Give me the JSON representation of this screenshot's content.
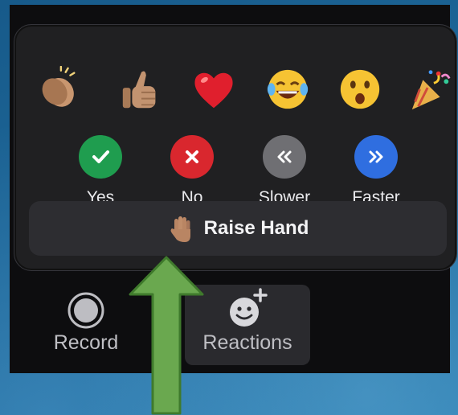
{
  "reactions": {
    "emojis": [
      {
        "name": "clapping-hands",
        "icon": "clap-icon"
      },
      {
        "name": "thumbs-up",
        "icon": "thumbs-up-icon"
      },
      {
        "name": "heart",
        "icon": "heart-icon"
      },
      {
        "name": "tears-of-joy",
        "icon": "laughing-emoji-icon"
      },
      {
        "name": "surprised",
        "icon": "open-mouth-emoji-icon"
      },
      {
        "name": "party-popper",
        "icon": "party-popper-icon"
      }
    ],
    "votes": [
      {
        "label": "Yes",
        "color": "#1f9d4f",
        "icon": "check-icon"
      },
      {
        "label": "No",
        "color": "#d9272e",
        "icon": "x-icon"
      },
      {
        "label": "Slower",
        "color": "#6f6f73",
        "icon": "double-chevron-left-icon"
      },
      {
        "label": "Faster",
        "color": "#2f6ee0",
        "icon": "double-chevron-right-icon"
      }
    ],
    "raise_hand": {
      "label": "Raise Hand",
      "icon": "raised-hand-icon"
    }
  },
  "toolbar": {
    "record": {
      "label": "Record",
      "icon": "record-icon"
    },
    "reactions": {
      "label": "Reactions",
      "icon": "smiley-plus-icon"
    }
  },
  "annotation": {
    "arrow_color": "#6aa84f",
    "arrow_border": "#3f7a2c",
    "icon": "green-arrow-up-icon"
  }
}
